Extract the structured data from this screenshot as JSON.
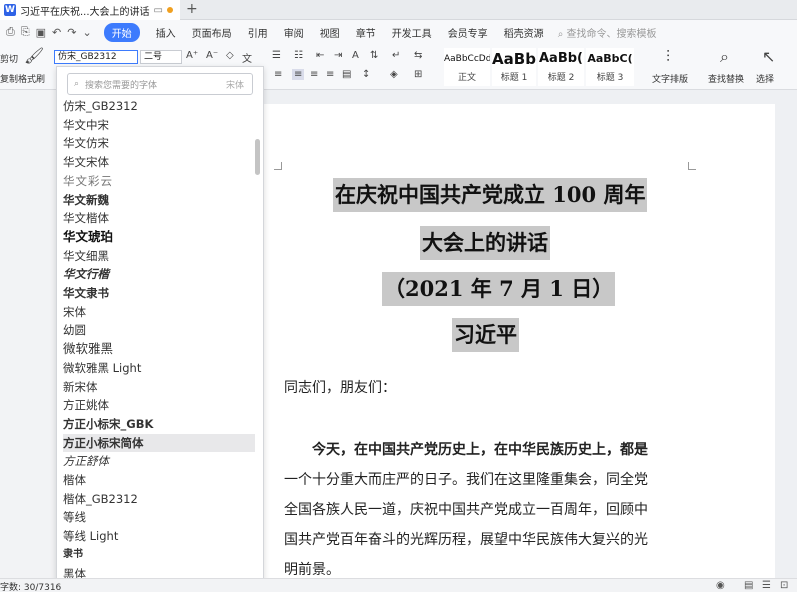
{
  "window": {
    "tab_title": "习近平在庆祝...大会上的讲话",
    "new_tab": "+"
  },
  "ribbon_tabs": {
    "items": [
      "开始",
      "插入",
      "页面布局",
      "引用",
      "审阅",
      "视图",
      "章节",
      "开发工具",
      "会员专享",
      "稻壳资源"
    ],
    "search": "查找命令、搜索模板"
  },
  "ribbon": {
    "cut": "剪切",
    "copy": "复制",
    "format_painter": "格式刷",
    "font_name": "仿宋_GB2312",
    "font_size": "二号",
    "styles": [
      {
        "sample": "AaBbCcDd",
        "name": "正文"
      },
      {
        "sample": "AaBb",
        "name": "标题 1"
      },
      {
        "sample": "AaBb(",
        "name": "标题 2"
      },
      {
        "sample": "AaBbC(",
        "name": "标题 3"
      }
    ],
    "text_layout": "文字排版",
    "find_replace": "查找替换",
    "select": "选择"
  },
  "font_dropdown": {
    "search_placeholder": "搜索您需要的字体",
    "search_hint": "宋体",
    "fonts": [
      "仿宋_GB2312",
      "华文中宋",
      "华文仿宋",
      "华文宋体",
      "华文彩云",
      "华文新魏",
      "华文楷体",
      "华文琥珀",
      "华文细黑",
      "华文行楷",
      "华文隶书",
      "宋体",
      "幼圆",
      "微软雅黑",
      "微软雅黑 Light",
      "新宋体",
      "方正姚体",
      "方正小标宋_GBK",
      "方正小标宋简体",
      "方正舒体",
      "楷体",
      "楷体_GB2312",
      "等线",
      "等线 Light",
      "隶书",
      "黑体"
    ],
    "highlighted_index": 18
  },
  "document": {
    "title_lines": [
      "在庆祝中国共产党成立 100 周年",
      "大会上的讲话",
      "（2021 年 7 月 1 日）",
      "习近平"
    ],
    "greeting": "同志们，朋友们：",
    "paragraph_lines": [
      "今天，在中国共产党历史上，在中华民族历史上，都是",
      "一个十分重大而庄严的日子。我们在这里隆重集会，同全党",
      "全国各族人民一道，庆祝中国共产党成立一百周年，回顾中",
      "国共产党百年奋斗的光辉历程，展望中华民族伟大复兴的光",
      "明前景。"
    ]
  },
  "status": {
    "word_count": "字数: 30/7316"
  }
}
